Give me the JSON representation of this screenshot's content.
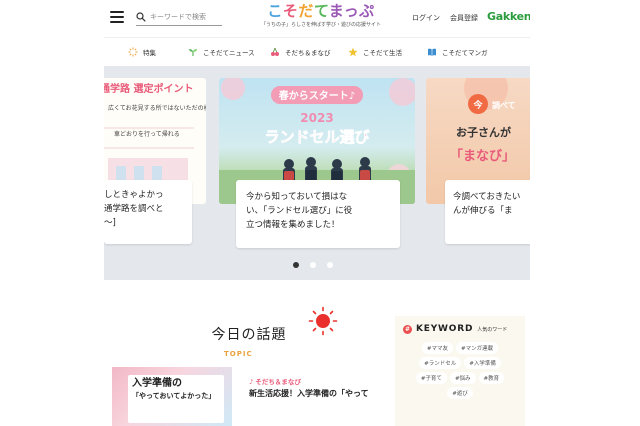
{
  "header": {
    "search_placeholder": "キーワードで検索",
    "logo": {
      "parts": [
        "こ",
        "そ",
        "だ",
        "て",
        "まっぷ"
      ],
      "subtitle": "「うちの子」らしさを伸ばす学び・遊びの応援サイト"
    },
    "login": "ログイン",
    "register": "会員登録",
    "brand": "Gakken"
  },
  "nav": {
    "items": [
      {
        "label": "特集",
        "icon": "sparkle-icon"
      },
      {
        "label": "こそだてニュース",
        "icon": "sprout-icon"
      },
      {
        "label": "そだち＆まなび",
        "icon": "cherry-icon"
      },
      {
        "label": "こそだて生活",
        "icon": "star-icon"
      },
      {
        "label": "こそだてマンガ",
        "icon": "book-icon"
      }
    ]
  },
  "carousel": {
    "left": {
      "image_text": [
        "通学路 選定ポイント",
        "広くてお花見する所ではないただの桜並木",
        "車どおりを行って帰れる"
      ],
      "card_lines": [
        "しときゃよかっ",
        "通学路を調べと",
        "〜]"
      ]
    },
    "center": {
      "banner_top": "春からスタート♪",
      "banner_year": "2023",
      "banner_title": "ランドセル選び",
      "card_lines": [
        "今から知っておいて損はな",
        "い、「ランドセル選び」に役",
        "立つ情報を集めました！"
      ]
    },
    "right": {
      "badge": "今",
      "badge_text": "調べて",
      "image_line1": "お子さんが",
      "image_line2": "「まなび」",
      "card_lines": [
        "今調べておきたい",
        "んが伸びる「ま"
      ]
    },
    "dots": 3,
    "active_dot": 0
  },
  "today": {
    "title": "今日の話題",
    "topic_label": "TOPIC",
    "image_text": [
      "入学準備の",
      "「やっておいてよかった」"
    ],
    "category": "そだち＆まなび",
    "headline": "新生活応援！入学準備の「やって"
  },
  "keyword": {
    "icon": "#",
    "title": "KEYWORD",
    "subtitle": "人気のワード",
    "tags": [
      "#ママ友",
      "#マンガ連載",
      "#ランドセル",
      "#入学準備",
      "#子育て",
      "#悩み",
      "#教育",
      "#遊び"
    ]
  },
  "colors": {
    "accent_green": "#2a9c3d",
    "accent_pink": "#e95b7a",
    "accent_orange": "#e9a13b",
    "carousel_bg": "#e4e8ed"
  }
}
